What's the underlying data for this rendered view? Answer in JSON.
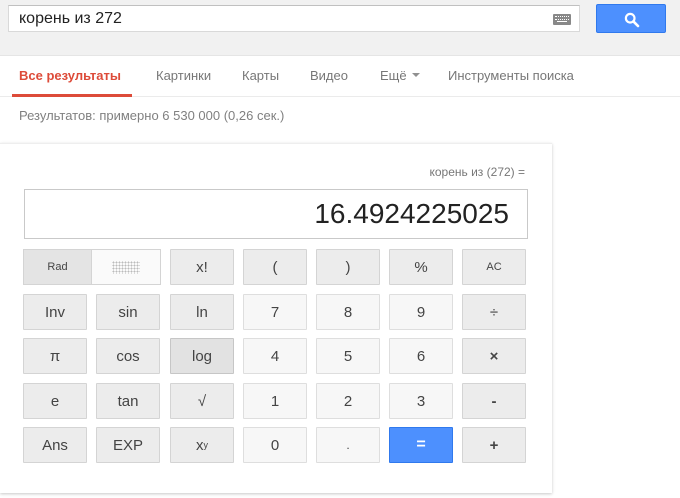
{
  "search": {
    "query": "корень из 272",
    "keyboard_icon": "keyboard-icon",
    "button_icon": "search-icon",
    "accent_color": "#4d90fe"
  },
  "tabs": [
    {
      "label": "Все результаты",
      "active": true
    },
    {
      "label": "Картинки"
    },
    {
      "label": "Карты"
    },
    {
      "label": "Видео"
    },
    {
      "label": "Ещё"
    },
    {
      "label": "Инструменты поиска"
    }
  ],
  "results_stats": "Результатов: примерно 6 530 000 (0,26 сек.)",
  "calculator": {
    "expression": "корень из (272) =",
    "result": "16.4924225025",
    "rad_label": "Rad",
    "keys": {
      "fact": "x!",
      "lparen": "(",
      "rparen": ")",
      "percent": "%",
      "ac": "AC",
      "inv": "Inv",
      "sin": "sin",
      "ln": "ln",
      "k7": "7",
      "k8": "8",
      "k9": "9",
      "divide": "÷",
      "pi": "π",
      "cos": "cos",
      "log": "log",
      "k4": "4",
      "k5": "5",
      "k6": "6",
      "multiply": "×",
      "e": "e",
      "tan": "tan",
      "sqrt": "√",
      "k1": "1",
      "k2": "2",
      "k3": "3",
      "minus": "-",
      "ans": "Ans",
      "exp": "EXP",
      "pow_base": "x",
      "pow_exp": "y",
      "k0": "0",
      "dot": ".",
      "equals": "=",
      "plus": "+"
    }
  }
}
